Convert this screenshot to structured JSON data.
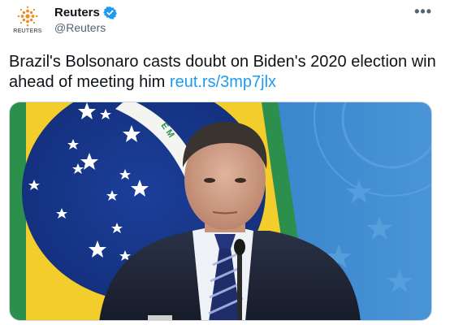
{
  "account": {
    "name": "Reuters",
    "handle": "@Reuters",
    "avatar_text": "REUTERS",
    "avatar_icon": "reuters-logo-icon",
    "verified_icon": "verified-badge-icon",
    "verified_color": "#1d9bf0"
  },
  "more_menu": {
    "label": "•••",
    "icon": "more-options-icon"
  },
  "tweet": {
    "text": "Brazil's Bolsonaro casts doubt on Biden's 2020 election win ahead of meeting him ",
    "link": "reut.rs/3mp7jlx",
    "link_color": "#1d9bf0"
  },
  "media": {
    "photo_icon": "news-photo-icon",
    "flag_banner_text": "E M"
  }
}
